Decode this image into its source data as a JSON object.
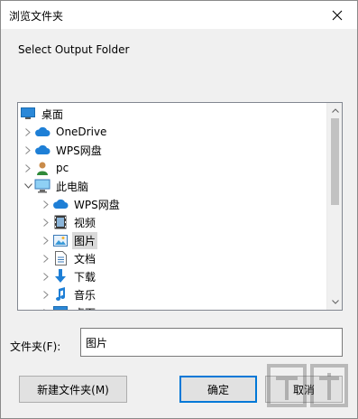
{
  "window": {
    "title": "浏览文件夹"
  },
  "prompt": "Select Output Folder",
  "tree": {
    "items": [
      {
        "label": "桌面",
        "level": 0,
        "icon": "desktop-icon",
        "chevron": ""
      },
      {
        "label": "OneDrive",
        "level": 1,
        "icon": "cloud-icon",
        "chevron": "right"
      },
      {
        "label": "WPS网盘",
        "level": 1,
        "icon": "cloud-icon",
        "chevron": "right"
      },
      {
        "label": "pc",
        "level": 1,
        "icon": "user-icon",
        "chevron": "right"
      },
      {
        "label": "此电脑",
        "level": 1,
        "icon": "computer-icon",
        "chevron": "down"
      },
      {
        "label": "WPS网盘",
        "level": 2,
        "icon": "cloud-icon",
        "chevron": "right"
      },
      {
        "label": "视频",
        "level": 2,
        "icon": "video-icon",
        "chevron": "right"
      },
      {
        "label": "图片",
        "level": 2,
        "icon": "picture-icon",
        "chevron": "right",
        "selected": true
      },
      {
        "label": "文档",
        "level": 2,
        "icon": "document-icon",
        "chevron": "right"
      },
      {
        "label": "下载",
        "level": 2,
        "icon": "download-icon",
        "chevron": "right"
      },
      {
        "label": "音乐",
        "level": 2,
        "icon": "music-icon",
        "chevron": "right"
      },
      {
        "label": "桌面",
        "level": 2,
        "icon": "desktop-icon",
        "chevron": "right"
      }
    ]
  },
  "folder_field": {
    "label": "文件夹(F):",
    "value": "图片"
  },
  "buttons": {
    "new_folder": "新建文件夹(M)",
    "ok": "确定",
    "cancel": "取消"
  },
  "colors": {
    "accent": "#0078d7",
    "selected": "#d9d9d9",
    "cloud": "#1e7fd6"
  }
}
